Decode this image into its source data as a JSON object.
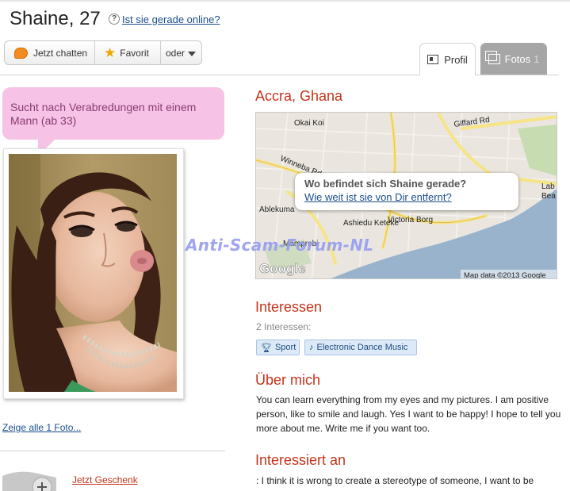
{
  "header": {
    "name_age": "Shaine, 27",
    "help_glyph": "?",
    "online_link": "Ist sie gerade online?"
  },
  "actions": {
    "chat_label": "Jetzt chatten",
    "favorite_label": "Favorit",
    "more_label": "oder"
  },
  "tabs": [
    {
      "label": "Profil",
      "active": true
    },
    {
      "label": "Fotos",
      "count": "1",
      "active": false
    }
  ],
  "sidebar": {
    "status_bubble": "Sucht nach Verabredungen mit einem Mann (ab 33)",
    "show_photos_link": "Zeige alle 1 Foto...",
    "gift_link": "Jetzt Geschenk"
  },
  "watermark": "Anti-Scam-Forum-NL",
  "location": {
    "title": "Accra, Ghana",
    "map": {
      "labels": [
        "Okai Koi",
        "Giffard Rd",
        "Winneba Rd",
        "Ablekuma",
        "Ashiedu Keteke",
        "Victoria Borg",
        "Mamprobi",
        "Lab",
        "Bea"
      ],
      "popup_question": "Wo befindet sich Shaine gerade?",
      "popup_link": "Wie weit ist sie von Dir entfernt?",
      "logo": "Google",
      "attribution": "Map data ©2013 Google"
    }
  },
  "interests": {
    "title": "Interessen",
    "count_label": "2 Interessen:",
    "tags": [
      {
        "label": "Sport",
        "icon": "trophy-icon"
      },
      {
        "label": "Electronic Dance Music",
        "icon": "music-note-icon"
      }
    ]
  },
  "about": {
    "title": "Über mich",
    "text": "You can learn everything from my eyes and my pictures. I am positive person, like to smile and laugh. Yes I want to be happy! I hope to tell you more about me. Write me if you want too."
  },
  "interested_in": {
    "title": "Interessiert an",
    "text": ": I think it is wrong to create a stereotype of someone, I want to be"
  },
  "colors": {
    "accent": "#c5331b",
    "link": "#1a4e8c",
    "bubble": "#f6c2e5",
    "tag_bg": "#dce9f7"
  }
}
